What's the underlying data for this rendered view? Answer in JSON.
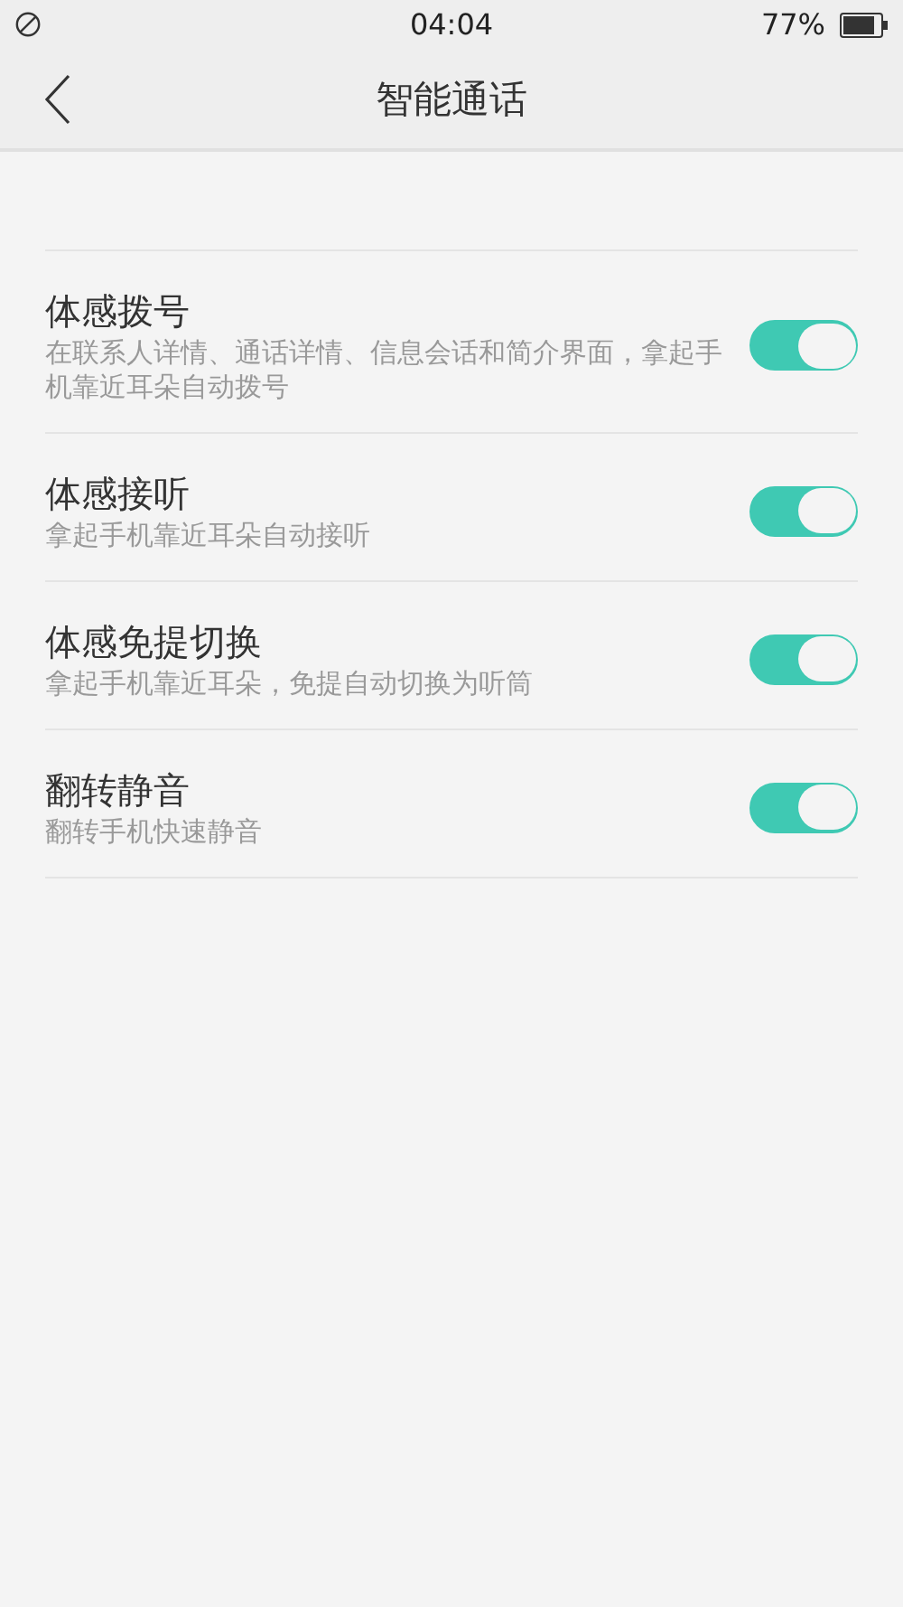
{
  "status_bar": {
    "time": "04:04",
    "battery": "77%"
  },
  "header": {
    "title": "智能通话"
  },
  "settings": [
    {
      "title": "体感拨号",
      "description": "在联系人详情、通话详情、信息会话和简介界面，拿起手机靠近耳朵自动拨号",
      "on": true
    },
    {
      "title": "体感接听",
      "description": "拿起手机靠近耳朵自动接听",
      "on": true
    },
    {
      "title": "体感免提切换",
      "description": "拿起手机靠近耳朵，免提自动切换为听筒",
      "on": true
    },
    {
      "title": "翻转静音",
      "description": "翻转手机快速静音",
      "on": true
    }
  ]
}
